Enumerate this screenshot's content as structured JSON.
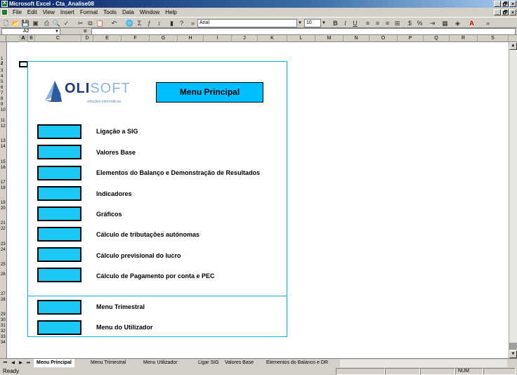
{
  "window": {
    "title": "Microsoft Excel - Cta_Analise08",
    "app_icon_label": "X"
  },
  "window_buttons": [
    "_",
    "🗗",
    "×"
  ],
  "menubar": {
    "items": [
      "File",
      "Edit",
      "View",
      "Insert",
      "Format",
      "Tools",
      "Data",
      "Window",
      "Help"
    ]
  },
  "toolbar": {
    "font_name": "Arial",
    "font_size": "10",
    "more": "»"
  },
  "formula_bar": {
    "cell_ref": "A2",
    "equals": "=",
    "content": ""
  },
  "columns": [
    "A",
    "B",
    "C",
    "D",
    "E",
    "F",
    "G",
    "H",
    "I",
    "J",
    "K",
    "L",
    "M",
    "N",
    "O",
    "P",
    "Q",
    "R",
    "S"
  ],
  "rows": [
    "1",
    "2",
    "3",
    "4",
    "5",
    "6",
    "7",
    "8",
    "9",
    "10",
    "11",
    "12",
    "13",
    "14",
    "15",
    "16",
    "17",
    "18",
    "19",
    "20",
    "21",
    "22",
    "23",
    "24",
    "25",
    "26",
    "27",
    "28",
    "29",
    "30",
    "31",
    "32",
    "33",
    "34"
  ],
  "logo": {
    "brand_part1": "OLI",
    "brand_part2": "SOFT",
    "tagline": "soluções informáticas"
  },
  "menu_title": "Menu Principal",
  "nav_items": [
    {
      "label": "Ligação a SIG"
    },
    {
      "label": "Valores Base"
    },
    {
      "label": "Elementos do Balanço e Demonstração de Resultados"
    },
    {
      "label": "Indicadores"
    },
    {
      "label": "Gráficos"
    },
    {
      "label": "Cálculo de tributações autónomas"
    },
    {
      "label": "Cálculo previsional do lucro"
    },
    {
      "label": "Cálculo de Pagamento por conta e PEC"
    },
    {
      "label": "Menu Trimestral"
    },
    {
      "label": "Menu do Utilizador"
    }
  ],
  "sheet_tabs": [
    "Menu Principal",
    "Menu Trimestral",
    "Menu Utilizador",
    "Ligar SIG",
    "Valores Base",
    "Elementos do Balanco e DR"
  ],
  "status": {
    "text": "Ready",
    "num": "NUM"
  },
  "colors": {
    "accent": "#00bfff",
    "button": "#1ec8f5",
    "border": "#00b4e4",
    "logo_dark": "#1a3a7a",
    "logo_light": "#8fb4e0"
  }
}
